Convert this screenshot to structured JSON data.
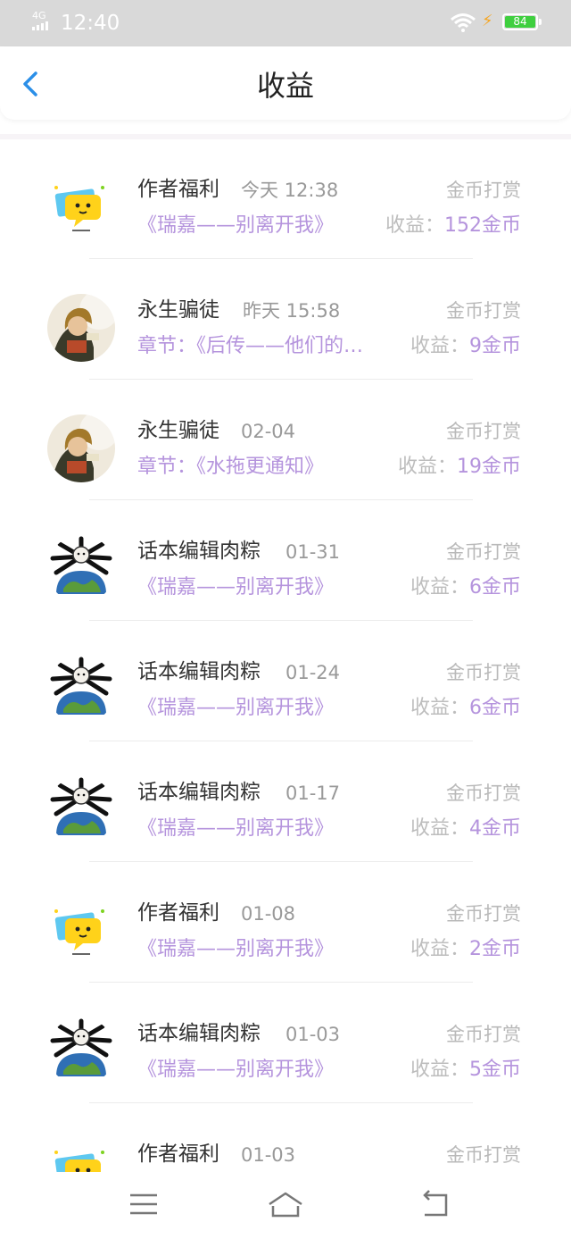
{
  "status_bar": {
    "network": "4G",
    "time": "12:40",
    "battery": "84"
  },
  "header": {
    "title": "收益"
  },
  "items": [
    {
      "name": "作者福利",
      "time": "今天 12:38",
      "type": "金币打赏",
      "work": "《瑞嘉——别离开我》",
      "income_label": "收益：",
      "income_amount": "152金币",
      "avatar": "chat-bubble"
    },
    {
      "name": "永生骗徒",
      "time": "昨天 15:58",
      "type": "金币打赏",
      "work": "章节：《后传——他们的…",
      "income_label": "收益：",
      "income_amount": "9金币",
      "avatar": "portrait"
    },
    {
      "name": "永生骗徒",
      "time": "02-04",
      "type": "金币打赏",
      "work": "章节：《水拖更通知》",
      "income_label": "收益：",
      "income_amount": "19金币",
      "avatar": "portrait"
    },
    {
      "name": "话本编辑肉粽",
      "time": "01-31",
      "type": "金币打赏",
      "work": "《瑞嘉——别离开我》",
      "income_label": "收益：",
      "income_amount": "6金币",
      "avatar": "globe-dog"
    },
    {
      "name": "话本编辑肉粽",
      "time": "01-24",
      "type": "金币打赏",
      "work": "《瑞嘉——别离开我》",
      "income_label": "收益：",
      "income_amount": "6金币",
      "avatar": "globe-dog"
    },
    {
      "name": "话本编辑肉粽",
      "time": "01-17",
      "type": "金币打赏",
      "work": "《瑞嘉——别离开我》",
      "income_label": "收益：",
      "income_amount": "4金币",
      "avatar": "globe-dog"
    },
    {
      "name": "作者福利",
      "time": "01-08",
      "type": "金币打赏",
      "work": "《瑞嘉——别离开我》",
      "income_label": "收益：",
      "income_amount": "2金币",
      "avatar": "chat-bubble"
    },
    {
      "name": "话本编辑肉粽",
      "time": "01-03",
      "type": "金币打赏",
      "work": "《瑞嘉——别离开我》",
      "income_label": "收益：",
      "income_amount": "5金币",
      "avatar": "globe-dog"
    },
    {
      "name": "作者福利",
      "time": "01-03",
      "type": "金币打赏",
      "work": "",
      "income_label": "",
      "income_amount": "",
      "avatar": "chat-bubble"
    }
  ],
  "colors": {
    "accent_purple": "#b594dd",
    "back_blue": "#2b8fe8",
    "battery_green": "#3fcf3f"
  },
  "nav_icons": [
    "menu-icon",
    "home-icon",
    "back-icon"
  ]
}
